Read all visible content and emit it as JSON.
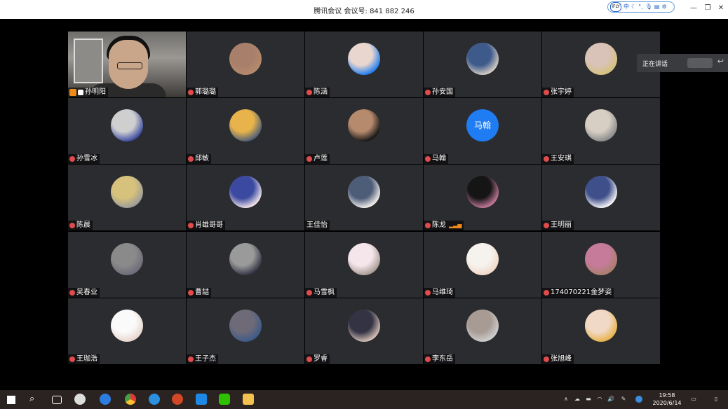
{
  "title": {
    "app": "腾讯会议",
    "meeting_label": "会议号:",
    "meeting_id": "841 882 246"
  },
  "ime": {
    "logo": "iFLY",
    "lang": "中"
  },
  "speaking": {
    "label": "正在讲话"
  },
  "participants": [
    {
      "name": "孙明阳",
      "host": true,
      "video": true
    },
    {
      "name": "郭璐璐"
    },
    {
      "name": "陈涵"
    },
    {
      "name": "孙安国"
    },
    {
      "name": "张宇婷"
    },
    {
      "name": "孙雪冰"
    },
    {
      "name": "邱敏"
    },
    {
      "name": "卢莲"
    },
    {
      "name": "马翰",
      "avatar_text": "马翰"
    },
    {
      "name": "王安琪"
    },
    {
      "name": "陈晨"
    },
    {
      "name": "肖雄哥哥"
    },
    {
      "name": "王佳怡",
      "no_mic": true
    },
    {
      "name": "陈龙",
      "signal": true
    },
    {
      "name": "王明丽"
    },
    {
      "name": "吴春业"
    },
    {
      "name": "曹喆"
    },
    {
      "name": "马雪枫"
    },
    {
      "name": "马维琦"
    },
    {
      "name": "174070221金梦姿"
    },
    {
      "name": "王珈浩"
    },
    {
      "name": "王子杰"
    },
    {
      "name": "罗睿"
    },
    {
      "name": "李东岳"
    },
    {
      "name": "张旭峰"
    }
  ],
  "taskbar": {
    "time": "19:58",
    "date": "2020/6/14"
  },
  "colors": {
    "tile_bg": "#2b2c2f",
    "accent_blue": "#1f7cf2",
    "host_orange": "#f08a1a",
    "mic_red": "#e04b4b"
  }
}
